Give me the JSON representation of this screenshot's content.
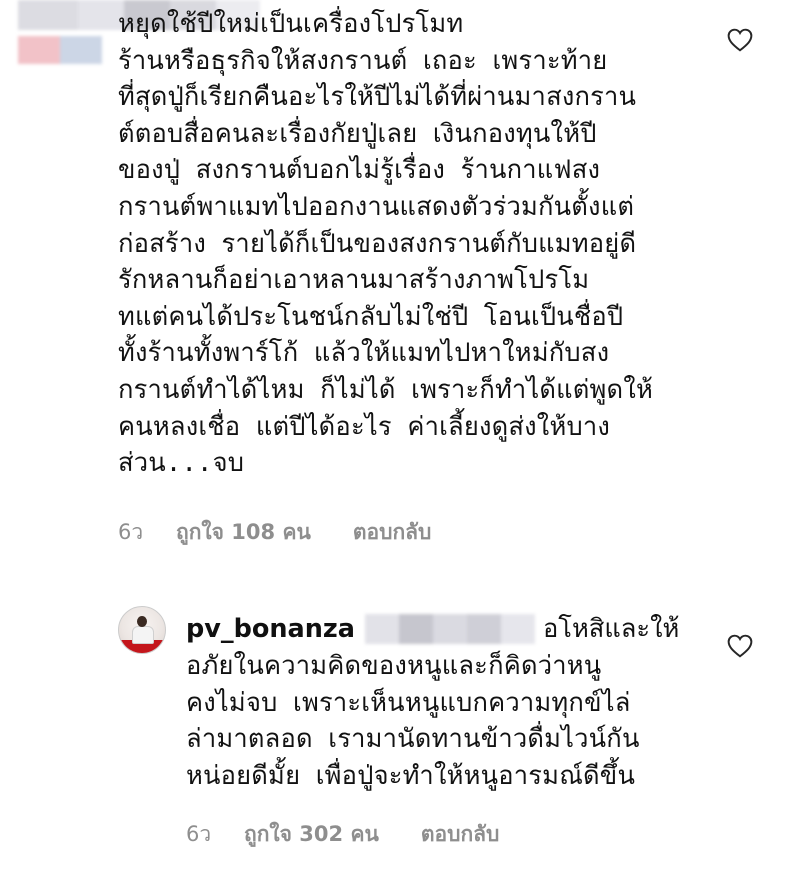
{
  "comments": [
    {
      "author": "",
      "text": "หยุดใช้ปีใหม่เป็นเครื่องโปรโมท\nร้านหรือธุรกิจให้สงกรานต์ เถอะ เพราะท้าย\nที่สุดปู่ก็เรียกคืนอะไรให้ปีไม่ได้ที่ผ่านมาสงกราน\nต์ตอบสื่อคนละเรื่องกัยปู่เลย เงินกองทุนให้ปี\nของปู่ สงกรานต์บอกไม่รู้เรื่อง ร้านกาแฟสง\nกรานต์พาแมทไปออกงานแสดงตัวร่วมกันตั้งแต่\nก่อสร้าง รายได้ก็เป็นของสงกรานต์กับแมทอยู่ดี\nรักหลานก็อย่าเอาหลานมาสร้างภาพโปรโม\nทแต่คนได้ประโนชน์กลับไม่ใช่ปี โอนเป็นชื่อปี\nทั้งร้านทั้งพาร์โก้ แล้วให้แมทไปหาใหม่กับสง\nกรานต์ทำได้ไหม ก็ไม่ได้ เพราะก็ทำได้แต่พูดให้\nคนหลงเชื่อ แต่ปีได้อะไร ค่าเลี้ยงดูส่งให้บาง\nส่วน...จบ",
      "time": "6ว",
      "likes": "ถูกใจ 108 คน",
      "reply": "ตอบกลับ",
      "like_icon": "heart-outline-icon"
    },
    {
      "author": "pv_bonanza",
      "header_tail": "อโหสิและให้",
      "text": "อภัยในความคิดของหนูและก็คิดว่าหนู\nคงไม่จบ เพราะเห็นหนูแบกความทุกข์ไล่\nล่ามาตลอด เรามานัดทานข้าวดื่มไวน์กัน\nหน่อยดีมั้ย เพื่อปู่จะทำให้หนูอารมณ์ดีขึ้น",
      "time": "6ว",
      "likes": "ถูกใจ 302 คน",
      "reply": "ตอบกลับ",
      "like_icon": "heart-outline-icon",
      "avatar_icon": "avatar"
    }
  ],
  "colors": {
    "text": "#121212",
    "meta": "#8e8e8e",
    "avatar_accent": "#c4161c"
  }
}
